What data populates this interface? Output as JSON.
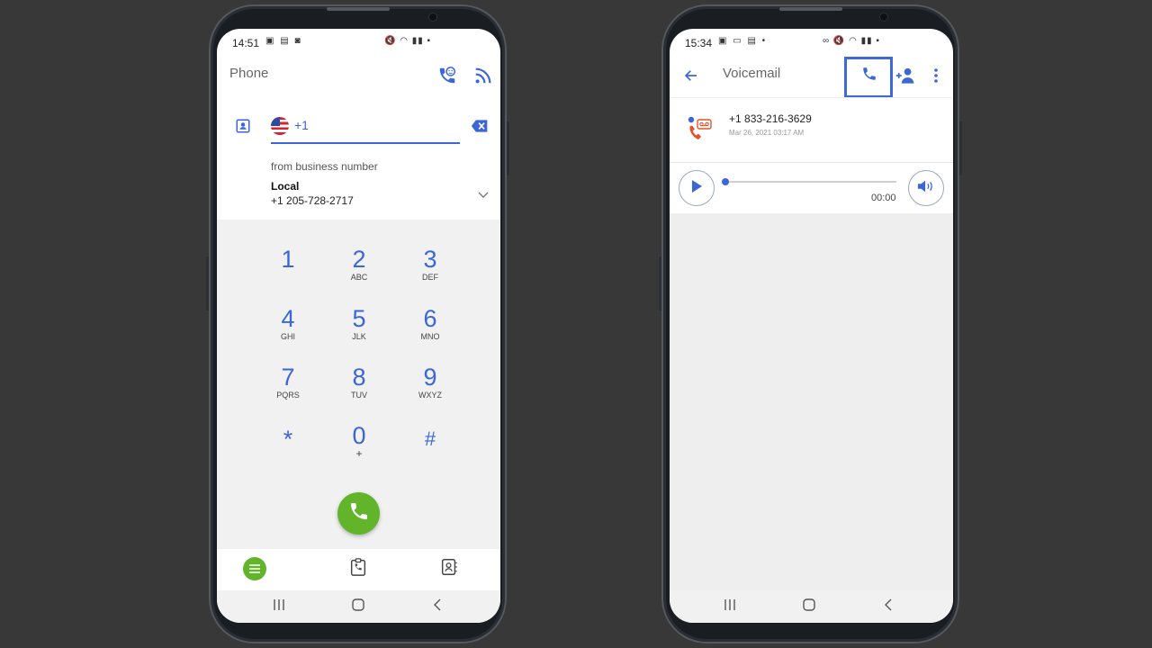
{
  "left_phone": {
    "status": {
      "time": "14:51"
    },
    "app_title": "Phone",
    "dialer": {
      "country_code": "+1",
      "from_label": "from business number",
      "number_name": "Local",
      "number_value": "+1 205-728-2717"
    },
    "keys": [
      {
        "num": "1",
        "letters": ""
      },
      {
        "num": "2",
        "letters": "ABC"
      },
      {
        "num": "3",
        "letters": "DEF"
      },
      {
        "num": "4",
        "letters": "GHI"
      },
      {
        "num": "5",
        "letters": "JLK"
      },
      {
        "num": "6",
        "letters": "MNO"
      },
      {
        "num": "7",
        "letters": "PQRS"
      },
      {
        "num": "8",
        "letters": "TUV"
      },
      {
        "num": "9",
        "letters": "WXYZ"
      },
      {
        "num": "*",
        "letters": ""
      },
      {
        "num": "0",
        "letters": "+"
      },
      {
        "num": "#",
        "letters": ""
      }
    ],
    "colors": {
      "accent": "#3a66d8",
      "call_green": "#62b52b"
    },
    "icons": [
      "contacts-card-icon",
      "us-flag-icon",
      "backspace-icon",
      "chevron-down-icon",
      "call-smile-icon",
      "rss-feed-icon",
      "call-icon",
      "menu-icon",
      "call-history-icon",
      "contact-book-icon"
    ]
  },
  "right_phone": {
    "status": {
      "time": "15:34"
    },
    "app_title": "Voicemail",
    "voicemail": {
      "number": "+1 833-216-3629",
      "datetime": "Mar 26, 2021 03:17 AM"
    },
    "player": {
      "time": "00:00",
      "progress": 0
    },
    "colors": {
      "accent": "#3a66d8",
      "voicemail_red": "#e0522a",
      "highlight": "#3d6ad6"
    },
    "icons": [
      "back-arrow-icon",
      "call-icon",
      "add-contact-icon",
      "more-vert-icon",
      "voicemail-icon",
      "play-icon",
      "volume-icon"
    ]
  }
}
